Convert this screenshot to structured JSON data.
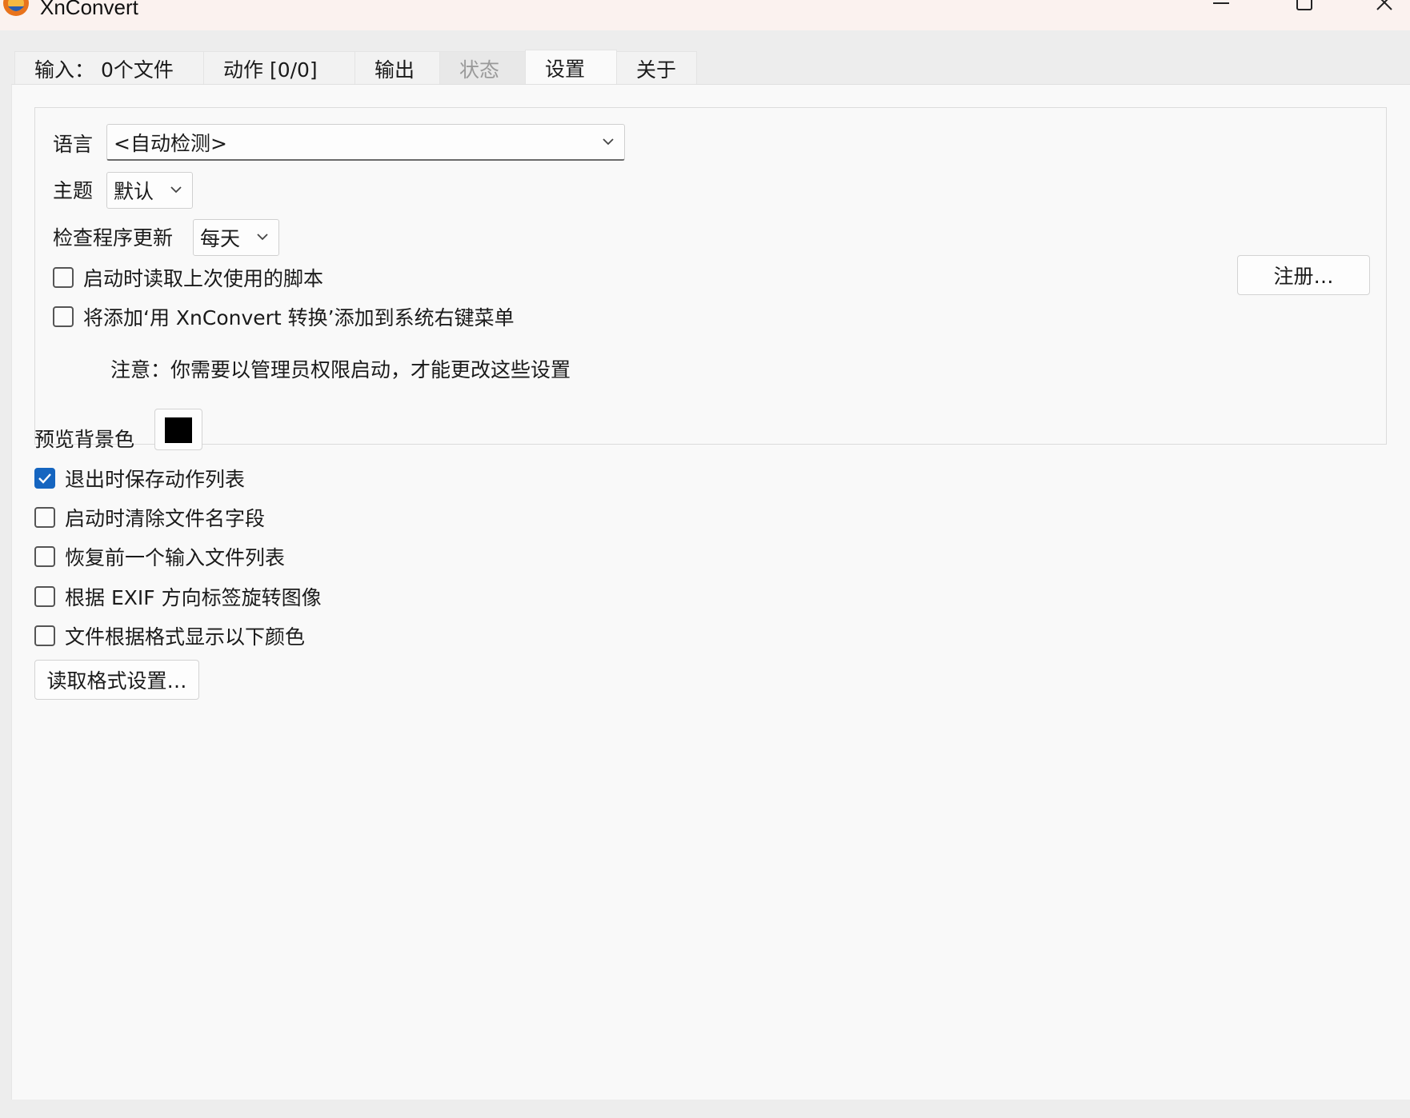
{
  "window": {
    "title": "XnConvert"
  },
  "tabs": [
    {
      "label": "输入：  0个文件",
      "state": "normal"
    },
    {
      "label": "动作 [0/0]",
      "state": "normal"
    },
    {
      "label": "输出",
      "state": "normal"
    },
    {
      "label": "状态",
      "state": "disabled"
    },
    {
      "label": "设置",
      "state": "active"
    },
    {
      "label": "关于",
      "state": "normal"
    }
  ],
  "settings": {
    "language": {
      "label": "语言",
      "value": "<自动检测>"
    },
    "theme": {
      "label": "主题",
      "value": "默认"
    },
    "update_check": {
      "label": "检查程序更新",
      "value": "每天"
    },
    "load_last_script": {
      "label": "启动时读取上次使用的脚本",
      "checked": false
    },
    "context_menu": {
      "label": "将添加‘用 XnConvert 转换’添加到系统右键菜单",
      "checked": false
    },
    "register_button": "注册…",
    "admin_note": "注意：你需要以管理员权限启动，才能更改这些设置",
    "preview_bg": {
      "label": "预览背景色",
      "color": "#000000"
    },
    "options": [
      {
        "label": "退出时保存动作列表",
        "checked": true
      },
      {
        "label": "启动时清除文件名字段",
        "checked": false
      },
      {
        "label": "恢复前一个输入文件列表",
        "checked": false
      },
      {
        "label": "根据 EXIF 方向标签旋转图像",
        "checked": false
      },
      {
        "label": "文件根据格式显示以下颜色",
        "checked": false
      }
    ],
    "read_format_button": "读取格式设置…"
  },
  "colors": {
    "accent": "#1565c0",
    "titlebar": "#fbf2ef"
  }
}
